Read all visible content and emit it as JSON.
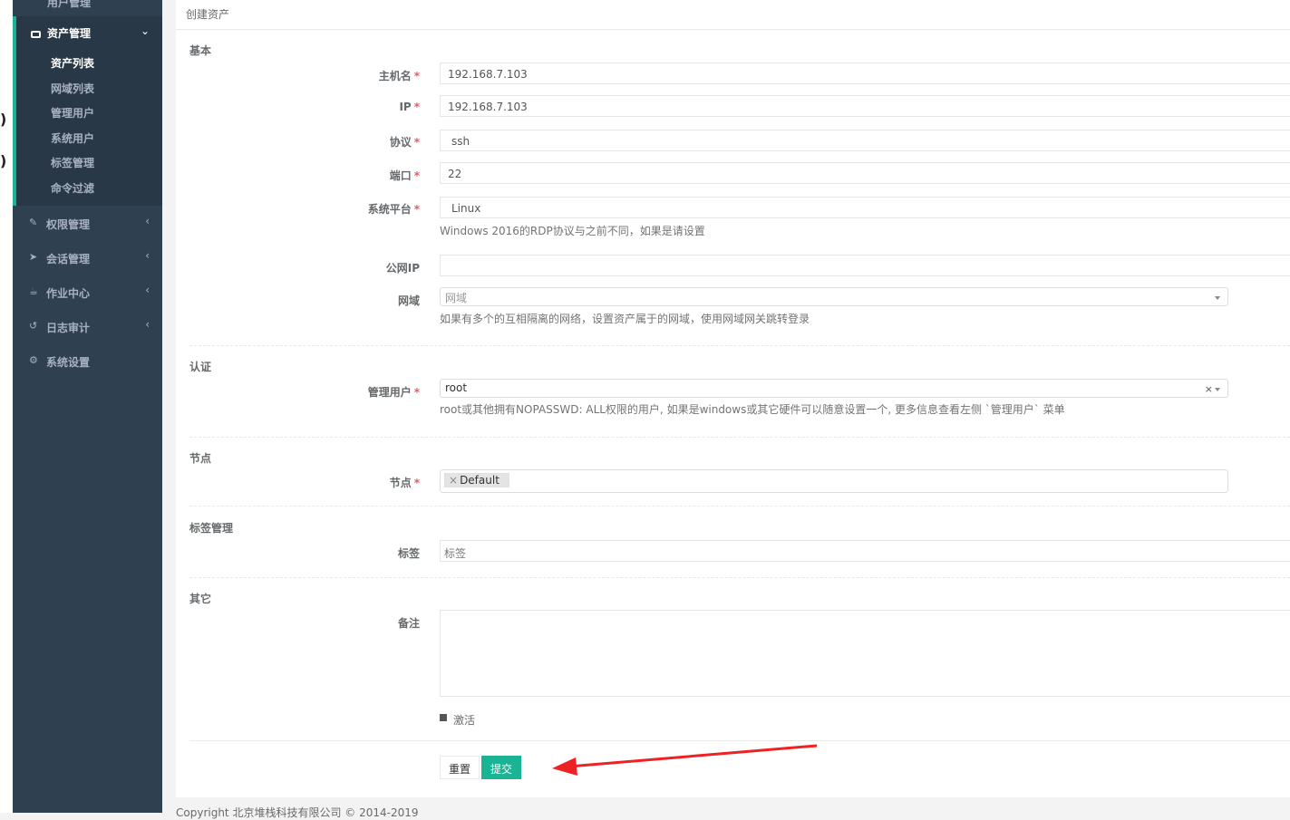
{
  "sidebar": {
    "top_item": "用户管理",
    "active_group": "资产管理",
    "sub_items": [
      "资产列表",
      "网域列表",
      "管理用户",
      "系统用户",
      "标签管理",
      "命令过滤"
    ],
    "items": [
      {
        "label": "权限管理",
        "icon": "edit-icon"
      },
      {
        "label": "会话管理",
        "icon": "rocket-icon"
      },
      {
        "label": "作业中心",
        "icon": "coffee-icon"
      },
      {
        "label": "日志审计",
        "icon": "history-icon"
      },
      {
        "label": "系统设置",
        "icon": "gears-icon"
      }
    ]
  },
  "page": {
    "title": "创建资产"
  },
  "sections": {
    "basic": "基本",
    "auth": "认证",
    "node": "节点",
    "tags": "标签管理",
    "other": "其它"
  },
  "fields": {
    "hostname": {
      "label": "主机名",
      "value": "192.168.7.103"
    },
    "ip": {
      "label": "IP",
      "value": "192.168.7.103"
    },
    "protocol": {
      "label": "协议",
      "value": "ssh"
    },
    "port": {
      "label": "端口",
      "value": "22"
    },
    "platform": {
      "label": "系统平台",
      "value": "Linux",
      "help": "Windows 2016的RDP协议与之前不同，如果是请设置"
    },
    "public_ip": {
      "label": "公网IP",
      "value": ""
    },
    "domain": {
      "label": "网域",
      "placeholder": "网域",
      "help": "如果有多个的互相隔离的网络，设置资产属于的网域，使用网域网关跳转登录"
    },
    "admin_user": {
      "label": "管理用户",
      "value": "root",
      "help": "root或其他拥有NOPASSWD: ALL权限的用户, 如果是windows或其它硬件可以随意设置一个, 更多信息查看左侧 `管理用户` 菜单"
    },
    "nodes": {
      "label": "节点",
      "tag": "Default"
    },
    "labels": {
      "label": "标签",
      "placeholder": "标签"
    },
    "comment": {
      "label": "备注",
      "value": ""
    },
    "active": {
      "label": "激活",
      "checked": true
    }
  },
  "buttons": {
    "reset": "重置",
    "submit": "提交"
  },
  "footer": "Copyright 北京堆栈科技有限公司 © 2014-2019",
  "colors": {
    "sidebar": "#2f4050",
    "accent": "#1ab394",
    "required": "#ed5565",
    "arrow": "#ee2222"
  }
}
